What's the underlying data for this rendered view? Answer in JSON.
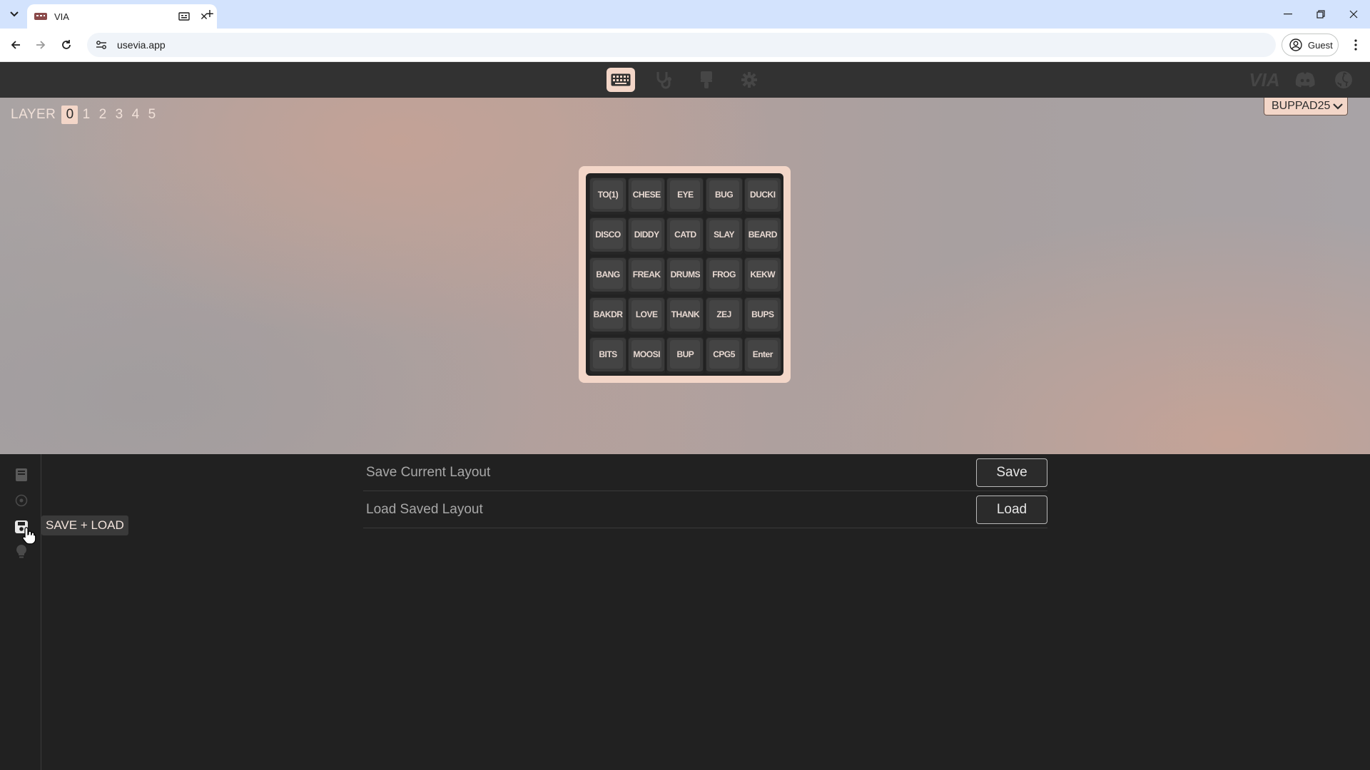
{
  "browser": {
    "tab_title": "VIA",
    "url": "usevia.app",
    "profile_label": "Guest"
  },
  "header": {
    "icons": [
      "keyboard-icon",
      "stethoscope-icon",
      "paintbrush-icon",
      "gear-icon"
    ],
    "external": [
      "via-logo",
      "discord-icon",
      "github-icon"
    ],
    "via_text": "VIA"
  },
  "layers": {
    "label": "LAYER",
    "items": [
      "0",
      "1",
      "2",
      "3",
      "4",
      "5"
    ],
    "active": "0"
  },
  "device": {
    "name": "BUPPAD25"
  },
  "keys": [
    "TO(1)",
    "CHESE",
    "EYE",
    "BUG",
    "DUCKI",
    "DISCO",
    "DIDDY",
    "CATD",
    "SLAY",
    "BEARD",
    "BANG",
    "FREAK",
    "DRUMS",
    "FROG",
    "KEKW",
    "BAKDR",
    "LOVE",
    "THANK",
    "ZEJ",
    "BUPS",
    "BITS",
    "MOOSI",
    "BUP",
    "CPG5",
    "Enter"
  ],
  "sidebar": {
    "icons": [
      "keyboard-layout-icon",
      "macro-icon",
      "save-icon",
      "lighting-icon"
    ],
    "tooltip": "SAVE + LOAD"
  },
  "save_load": {
    "save_label": "Save Current Layout",
    "save_button": "Save",
    "load_label": "Load Saved Layout",
    "load_button": "Load"
  },
  "colors": {
    "accent": "#f3d6c8",
    "panel": "#212121",
    "header": "#323232"
  }
}
